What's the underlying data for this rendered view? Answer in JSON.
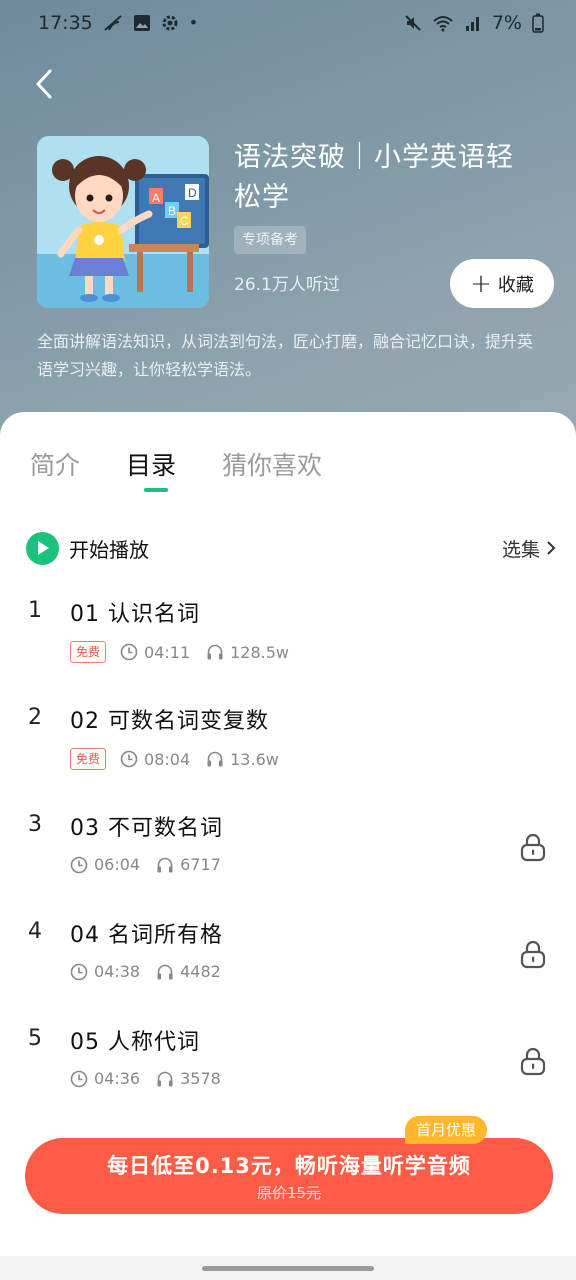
{
  "status_bar": {
    "time": "17:35",
    "left_icons": [
      "wifi-off-icon",
      "image-icon",
      "gear-icon",
      "dot-icon"
    ],
    "battery": "7%"
  },
  "album": {
    "title": "语法突破｜小学英语轻松学",
    "tag": "专项备考",
    "listens": "26.1万人听过",
    "favorite_label": "收藏",
    "description": "全面讲解语法知识，从词法到句法，匠心打磨，融合记忆口诀，提升英语学习兴趣，让你轻松学语法。",
    "cover_letters": [
      "A",
      "B",
      "C",
      "D"
    ]
  },
  "tabs": [
    {
      "label": "简介",
      "active": false
    },
    {
      "label": "目录",
      "active": true
    },
    {
      "label": "猜你喜欢",
      "active": false
    }
  ],
  "playlist": {
    "play_label": "开始播放",
    "select_label": "选集"
  },
  "episodes": [
    {
      "index": "1",
      "title": "01 认识名词",
      "badge": "免费",
      "duration": "04:11",
      "plays": "128.5w",
      "locked": false
    },
    {
      "index": "2",
      "title": "02 可数名词变复数",
      "badge": "免费",
      "duration": "08:04",
      "plays": "13.6w",
      "locked": false
    },
    {
      "index": "3",
      "title": "03 不可数名词",
      "badge": "",
      "duration": "06:04",
      "plays": "6717",
      "locked": true
    },
    {
      "index": "4",
      "title": "04 名词所有格",
      "badge": "",
      "duration": "04:38",
      "plays": "4482",
      "locked": true
    },
    {
      "index": "5",
      "title": "05 人称代词",
      "badge": "",
      "duration": "04:36",
      "plays": "3578",
      "locked": true
    }
  ],
  "promo": {
    "badge": "首月优惠",
    "main": "每日低至0.13元，畅听海量听学音频",
    "original_price": "原价15元"
  },
  "colors": {
    "accent_green": "#19c37d",
    "promo_red": "#fc5b45",
    "promo_badge": "#ffb72c",
    "free_badge": "#f0544a"
  }
}
